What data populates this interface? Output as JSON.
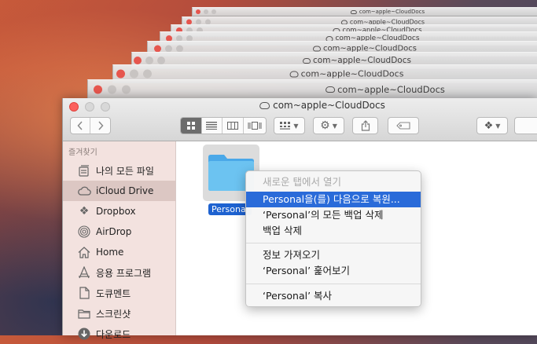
{
  "background_windows": [
    {
      "title": "com~apple~CloudDocs"
    },
    {
      "title": "com~apple~CloudDocs"
    },
    {
      "title": "com~apple~CloudDocs"
    },
    {
      "title": "com~apple~CloudDocs"
    },
    {
      "title": "com~apple~CloudDocs"
    },
    {
      "title": "com~apple~CloudDocs"
    },
    {
      "title": "com~apple~CloudDocs"
    },
    {
      "title": "com~apple~CloudDocs"
    }
  ],
  "window": {
    "title": "com~apple~CloudDocs",
    "title_icon": "cloud-icon"
  },
  "toolbar": {
    "back_icon": "chevron-left-icon",
    "forward_icon": "chevron-right-icon",
    "view_modes": [
      "icon-view-icon",
      "list-view-icon",
      "column-view-icon",
      "cover-flow-icon"
    ],
    "active_view": "icon-view-icon",
    "arrange_icon": "arrange-grid-icon",
    "action_icon": "gear-icon",
    "share_icon": "share-icon",
    "tag_icon": "tag-icon",
    "dropbox_icon": "dropbox-icon"
  },
  "sidebar": {
    "heading": "즐겨찾기",
    "items": [
      {
        "label": "나의 모든 파일",
        "icon": "all-files-icon",
        "selected": false
      },
      {
        "label": "iCloud Drive",
        "icon": "cloud-icon",
        "selected": true
      },
      {
        "label": "Dropbox",
        "icon": "dropbox-icon",
        "selected": false
      },
      {
        "label": "AirDrop",
        "icon": "airdrop-icon",
        "selected": false
      },
      {
        "label": "Home",
        "icon": "home-icon",
        "selected": false
      },
      {
        "label": "응용 프로그램",
        "icon": "applications-icon",
        "selected": false
      },
      {
        "label": "도큐멘트",
        "icon": "documents-icon",
        "selected": false
      },
      {
        "label": "스크린샷",
        "icon": "folder-icon",
        "selected": false
      },
      {
        "label": "다운로드",
        "icon": "downloads-icon",
        "selected": false
      }
    ]
  },
  "content": {
    "folder": {
      "label": "Persona",
      "icon": "folder-icon"
    }
  },
  "context_menu": {
    "items": [
      {
        "label": "새로운 탭에서 열기",
        "state": "disabled"
      },
      {
        "label": "Personal을(를) 다음으로 복원...",
        "state": "highlighted"
      },
      {
        "label": "‘Personal’의 모든 백업 삭제",
        "state": "normal"
      },
      {
        "label": "백업 삭제",
        "state": "normal"
      },
      {
        "label": "정보 가져오기",
        "state": "normal"
      },
      {
        "label": "‘Personal’ 훑어보기",
        "state": "normal"
      },
      {
        "label": "‘Personal’ 복사",
        "state": "normal"
      }
    ]
  },
  "colors": {
    "selection": "#2a6bd9",
    "sidebar_bg": "#f3e2df",
    "folder_blue": "#6cc3f1",
    "close_red": "#fc605c"
  }
}
